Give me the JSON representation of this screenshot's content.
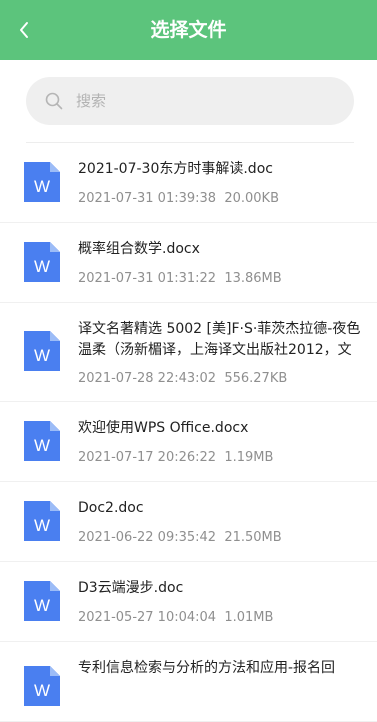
{
  "header": {
    "title": "选择文件",
    "back_icon": "chevron-left-icon"
  },
  "search": {
    "placeholder": "搜索",
    "icon": "search-icon",
    "value": ""
  },
  "files": [
    {
      "name": "2021-07-30东方时事解读.doc",
      "date": "2021-07-31 01:39:38",
      "size": "20.00KB"
    },
    {
      "name": "概率组合数学.docx",
      "date": "2021-07-31 01:31:22",
      "size": "13.86MB"
    },
    {
      "name": "译文名著精选 5002 [美]F·S·菲茨杰拉德-夜色温柔（汤新楣译，上海译文出版社2012，文",
      "date": "2021-07-28 22:43:02",
      "size": "556.27KB"
    },
    {
      "name": "欢迎使用WPS Office.docx",
      "date": "2021-07-17 20:26:22",
      "size": "1.19MB"
    },
    {
      "name": "Doc2.doc",
      "date": "2021-06-22 09:35:42",
      "size": "21.50MB"
    },
    {
      "name": "D3云端漫步.doc",
      "date": "2021-05-27 10:04:04",
      "size": "1.01MB"
    },
    {
      "name": "专利信息检索与分析的方法和应用-报名回",
      "date": "",
      "size": ""
    }
  ],
  "colors": {
    "header_bg": "#5cc47c",
    "doc_icon_blue": "#4a7ff0"
  },
  "file_icon": "word-document-icon",
  "file_icon_letter": "W"
}
